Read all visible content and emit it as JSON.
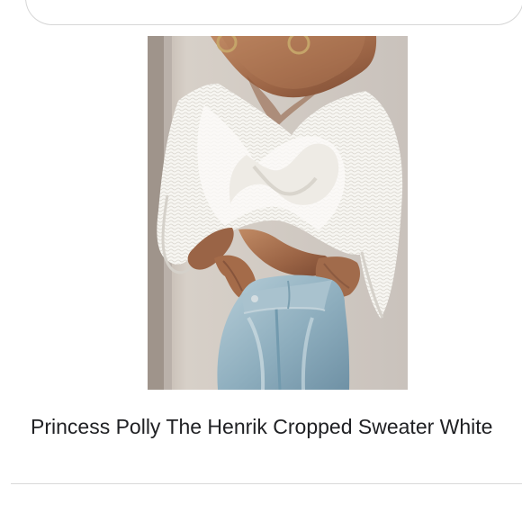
{
  "result": {
    "title": "Princess Polly The Henrik Cropped Sweater White",
    "image_subject": "model-wearing-white-off-shoulder-twist-front-cropped-sweater-and-light-wash-jeans"
  },
  "colors": {
    "background": "#ffffff",
    "title_text": "#202124",
    "divider": "#d9d9d9",
    "sweater": "#f4f2ee",
    "denim": "#9cb7c6",
    "skin": "#a8734f"
  },
  "icons": {
    "product_image": "product-photo"
  }
}
